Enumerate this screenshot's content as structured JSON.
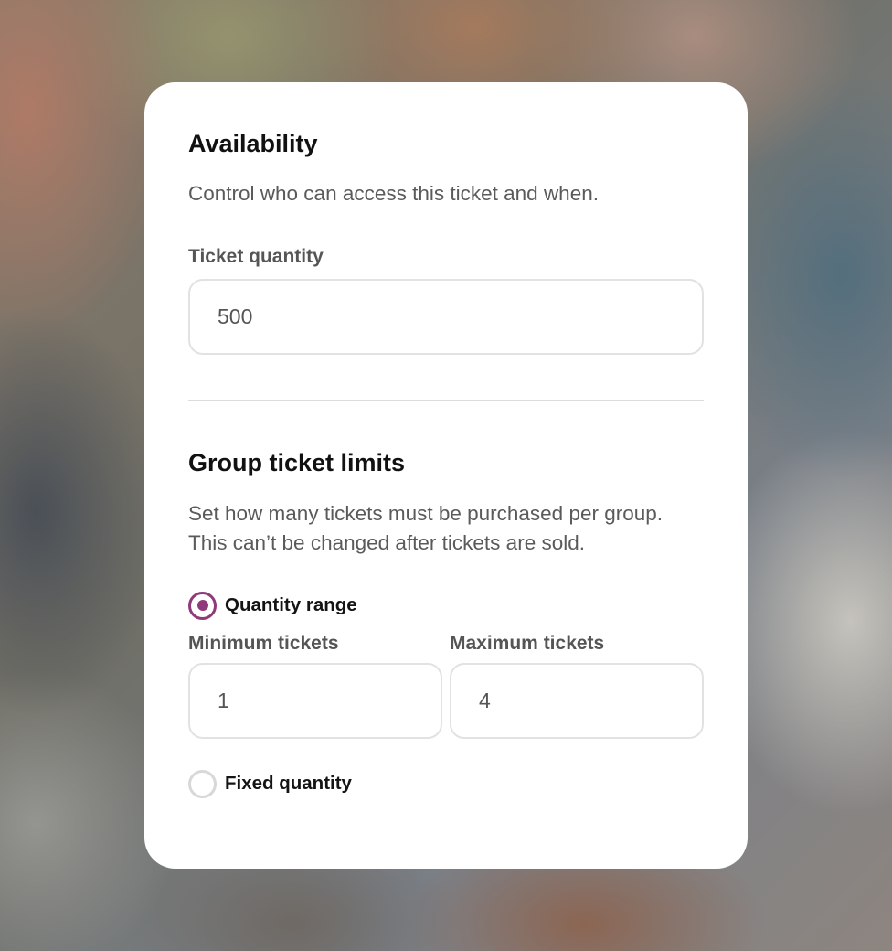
{
  "availability": {
    "title": "Availability",
    "description": "Control who can access this ticket and when.",
    "ticket_quantity_label": "Ticket quantity",
    "ticket_quantity_value": "500"
  },
  "group_limits": {
    "title": "Group ticket limits",
    "description": "Set how many tickets must be purchased per group. This can’t be changed after tickets are sold.",
    "options": [
      {
        "label": "Quantity range",
        "selected": true
      },
      {
        "label": "Fixed quantity",
        "selected": false
      }
    ],
    "minimum_label": "Minimum tickets",
    "minimum_value": "1",
    "maximum_label": "Maximum tickets",
    "maximum_value": "4"
  },
  "colors": {
    "accent": "#8f3b7a",
    "card_background": "#ffffff",
    "input_border": "#e2e2e2"
  }
}
